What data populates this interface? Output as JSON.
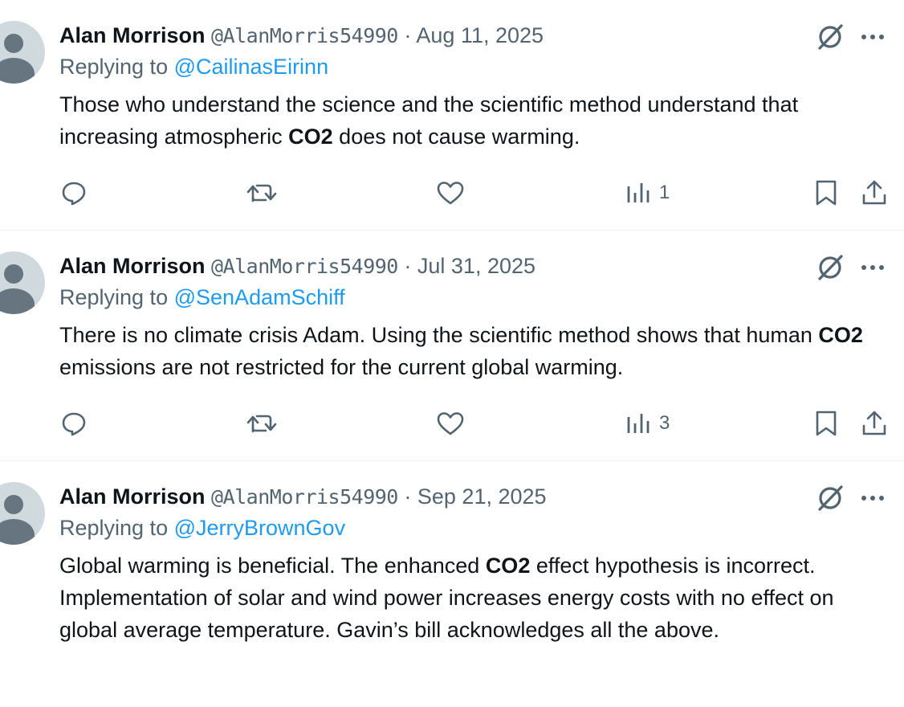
{
  "tweets": [
    {
      "name": "Alan Morrison",
      "handle": "@AlanMorris54990",
      "separator": "·",
      "date": "Aug 11, 2025",
      "replying_label": "Replying to",
      "replying_to": "@CailinasEirinn",
      "text_before": "Those who understand the science and the scientific method understand that increasing atmospheric ",
      "text_bold": "CO2",
      "text_after": " does not cause warming.",
      "views": "1"
    },
    {
      "name": "Alan Morrison",
      "handle": "@AlanMorris54990",
      "separator": "·",
      "date": "Jul 31, 2025",
      "replying_label": "Replying to",
      "replying_to": "@SenAdamSchiff",
      "text_before": "There is no climate crisis Adam.  Using the scientific method shows that human ",
      "text_bold": "CO2",
      "text_after": " emissions are not restricted for the current global warming.",
      "views": "3"
    },
    {
      "name": "Alan Morrison",
      "handle": "@AlanMorris54990",
      "separator": "·",
      "date": "Sep 21, 2025",
      "replying_label": "Replying to",
      "replying_to": "@JerryBrownGov",
      "text_before": "Global warming is beneficial.  The enhanced ",
      "text_bold": "CO2",
      "text_after": " effect hypothesis is incorrect.  Implementation of solar and wind power increases energy costs with no effect on global average temperature.  Gavin’s bill acknowledges all the above."
    }
  ],
  "icons": {
    "reply": "reply-icon",
    "retweet": "retweet-icon",
    "like": "like-icon",
    "views": "views-icon",
    "bookmark": "bookmark-icon",
    "share": "share-icon",
    "grok": "grok-icon",
    "more": "more-icon"
  },
  "colors": {
    "link": "#1d9bf0",
    "muted": "#536471",
    "text": "#0f1419"
  }
}
